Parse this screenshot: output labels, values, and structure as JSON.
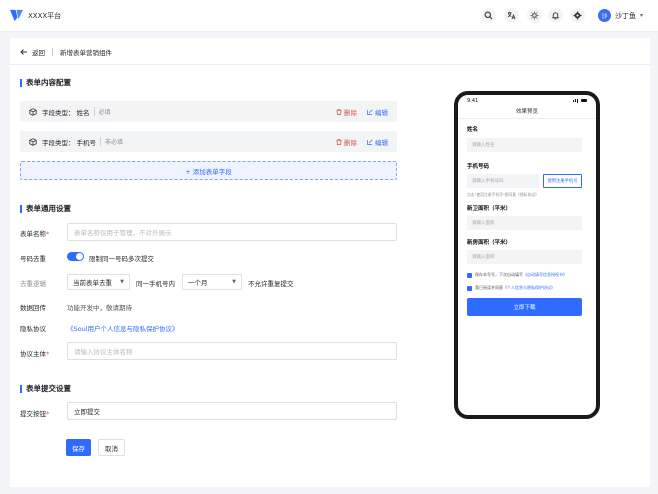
{
  "app": {
    "title": "XXXX平台"
  },
  "user": {
    "avatar_initial": "沙",
    "name": "沙丁鱼"
  },
  "header_icons": [
    "search-icon",
    "translate-icon",
    "theme-icon",
    "bell-icon",
    "gear-icon"
  ],
  "breadcrumb": {
    "back_label": "返回",
    "current": "新增表单营销组件"
  },
  "sections": {
    "content": "表单内容配置",
    "general": "表单通用设置",
    "submit": "表单提交设置"
  },
  "fields": [
    {
      "type_label": "字段类型：",
      "name": "姓名",
      "required": "必填",
      "delete": "删除",
      "edit": "编辑"
    },
    {
      "type_label": "字段类型：",
      "name": "手机号",
      "required": "非必填",
      "delete": "删除",
      "edit": "编辑"
    }
  ],
  "add_field_label": "+ 添加表单字段",
  "general": {
    "form_name_label": "表单名称",
    "form_name_placeholder": "表单名称仅用于管理，不对外展示",
    "dedup_label": "号码去重",
    "dedup_text": "限制同一号码多次提交",
    "dedup_logic_label": "去重逻辑",
    "dedup_scope": "当前表单去重",
    "same_phone_text": "同一手机号内",
    "period": "一个月",
    "no_repeat_text": "不允许重复提交",
    "data_return_label": "数据回传",
    "data_return_text": "功能开发中，敬请期待",
    "privacy_label": "隐私协议",
    "privacy_link": "《Soul用户个人信息与隐私保护协议》",
    "entity_label": "协议主体",
    "entity_placeholder": "请输入协议主体名称"
  },
  "submit": {
    "button_label": "提交按钮",
    "button_value": "立即提交"
  },
  "actions": {
    "save": "保存",
    "cancel": "取消"
  },
  "preview": {
    "time": "9:41",
    "title": "效果预览",
    "name_label": "姓名",
    "name_placeholder": "请输入姓名",
    "phone_label": "手机号码",
    "phone_placeholder": "请输入手机号码",
    "phone_alt_button": "使用注册手机号",
    "phone_hint": "点击\"使用注册手机号\"即同意《隐私协议》",
    "newcount_label": "新卫面积（平米）",
    "newcount_placeholder": "请输入面积",
    "newarea_label": "新房面积（平米）",
    "newarea_placeholder": "请输入面积",
    "check1_text": "保存本号号，下次自动填写",
    "check1_link": "《自动填写信息授权书》",
    "check2_text": "我已阅读并同意",
    "check2_link": "《个人信息与隐私保护协议》",
    "submit_label": "立即下载"
  },
  "colors": {
    "primary": "#2f6bff",
    "danger": "#e34d4d",
    "background": "#f3f4f7"
  }
}
